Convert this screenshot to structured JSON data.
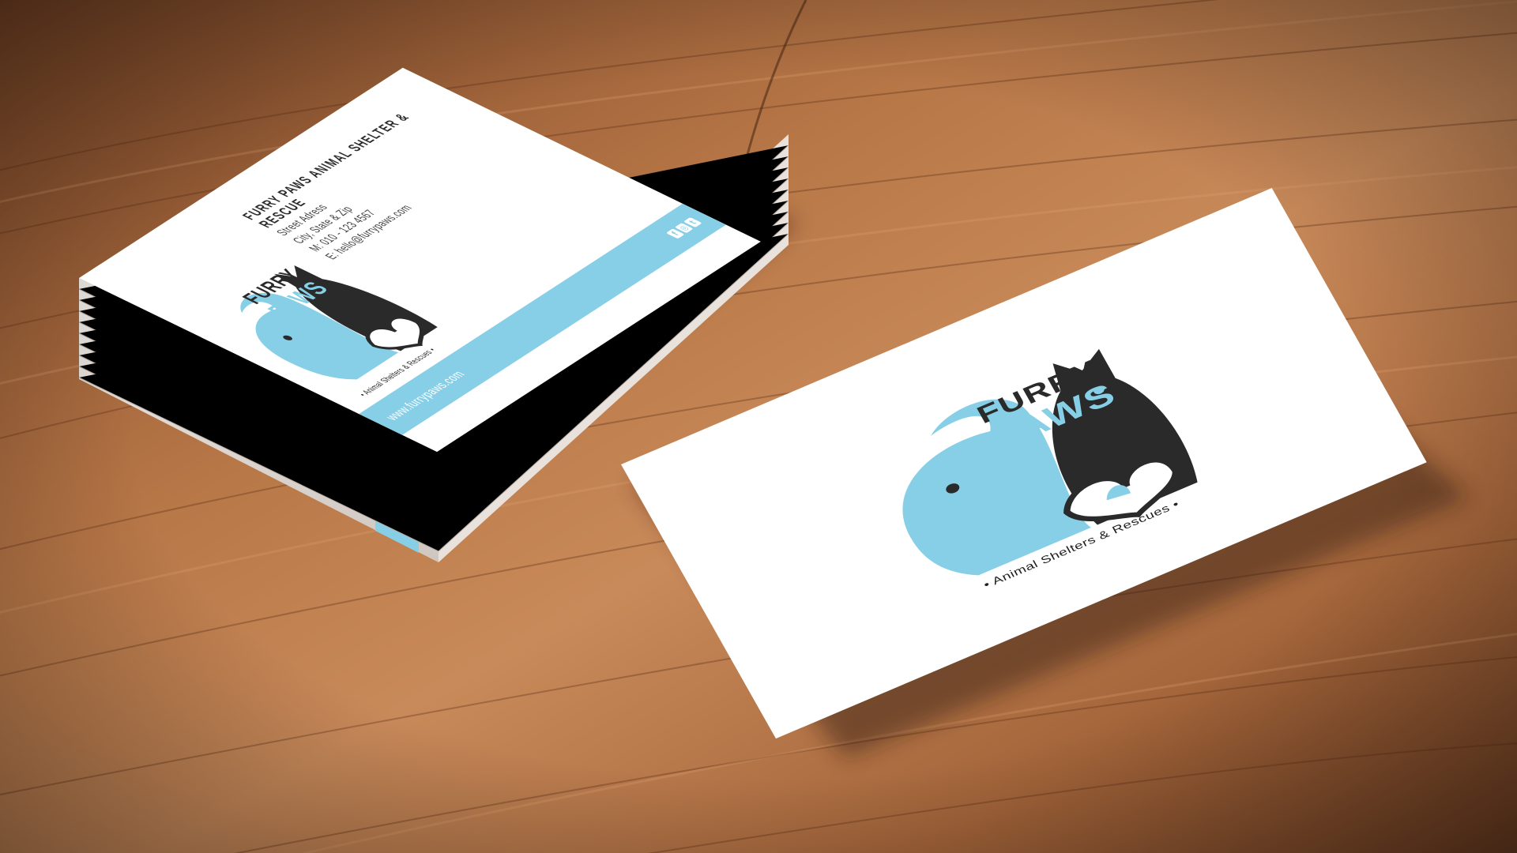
{
  "scene": {
    "surface": "wooden-table",
    "colors": {
      "wood_light": "#c98a5a",
      "wood_dark": "#6e3e22",
      "brand_blue": "#86cfe6",
      "brand_dark": "#2a2a2a",
      "card_white": "#ffffff"
    }
  },
  "logo": {
    "word_top": "FURRY",
    "word_bottom": "PAWS",
    "tagline": "• Animal Shelters & Rescues •"
  },
  "stack_card": {
    "company": "Furry Paws Animal Shelter & Rescue",
    "address_line": "Street Adress",
    "city_line": "City, State & Zip",
    "phone_line": "M: 010 - 123 4567",
    "email_line": "E: hello@furrypaws.com",
    "website": "www.furrypaws.com",
    "social_icons": [
      "facebook-icon",
      "instagram-icon",
      "twitter-icon"
    ],
    "social_glyphs": [
      "f",
      "◎",
      "t"
    ]
  },
  "front_card": {
    "side": "logo"
  }
}
